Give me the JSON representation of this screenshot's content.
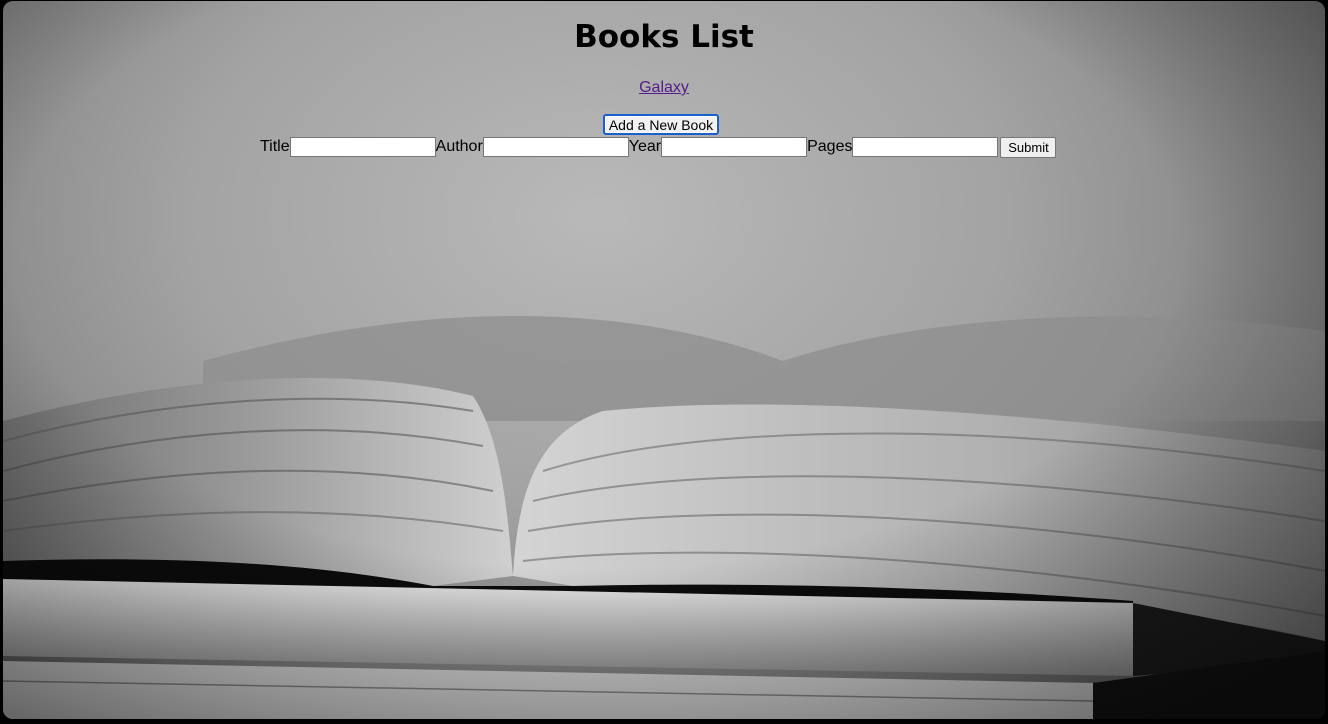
{
  "page": {
    "title": "Books List",
    "nav_link": "Galaxy",
    "add_button": "Add a New Book"
  },
  "form": {
    "fields": [
      {
        "label": "Title",
        "value": ""
      },
      {
        "label": "Author",
        "value": ""
      },
      {
        "label": "Year",
        "value": ""
      },
      {
        "label": "Pages",
        "value": ""
      }
    ],
    "submit_label": "Submit"
  },
  "background": {
    "subject": "open-book-photo",
    "tone": "grayscale"
  }
}
